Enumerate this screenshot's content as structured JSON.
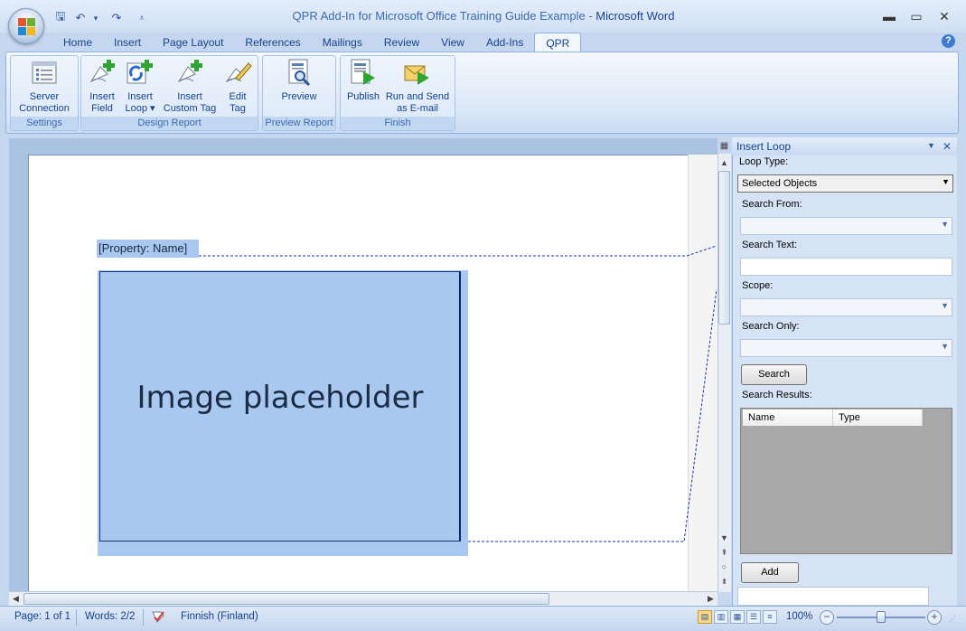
{
  "window": {
    "title_doc": "QPR Add-In for Microsoft Office Training Guide Example",
    "title_sep": " - ",
    "title_app": "Microsoft Word",
    "minimize": "▬",
    "maximize": "▭",
    "close": "✕"
  },
  "qat": {
    "save": "🖫",
    "undo": "↶",
    "undo_dd": "▾",
    "redo": "↷",
    "customize": "⩡"
  },
  "tabs": [
    "Home",
    "Insert",
    "Page Layout",
    "References",
    "Mailings",
    "Review",
    "View",
    "Add-Ins",
    "QPR"
  ],
  "help": "?",
  "ribbon": {
    "groups": [
      {
        "label": "Settings",
        "buttons": [
          {
            "l1": "Server",
            "l2": "Connection"
          }
        ]
      },
      {
        "label": "Design Report",
        "buttons": [
          {
            "l1": "Insert",
            "l2": "Field"
          },
          {
            "l1": "Insert",
            "l2": "Loop ▾"
          },
          {
            "l1": "Insert",
            "l2": "Custom Tag"
          },
          {
            "l1": "Edit",
            "l2": "Tag"
          }
        ]
      },
      {
        "label": "Preview Report",
        "buttons": [
          {
            "l1": "Preview",
            "l2": ""
          }
        ]
      },
      {
        "label": "Finish",
        "buttons": [
          {
            "l1": "Publish",
            "l2": ""
          },
          {
            "l1": "Run and Send",
            "l2": "as E-mail"
          }
        ]
      }
    ]
  },
  "document": {
    "field": "[Property: Name]",
    "image_text": "Image placeholder"
  },
  "pane": {
    "title": "Insert Loop",
    "menu": "▼",
    "close": "✕",
    "loop_type_label": "Loop Type:",
    "loop_type_value": "Selected Objects",
    "search_from_label": "Search From:",
    "search_text_label": "Search Text:",
    "scope_label": "Scope:",
    "search_only_label": "Search Only:",
    "search_button": "Search",
    "results_label": "Search Results:",
    "col_name": "Name",
    "col_type": "Type",
    "add_button": "Add"
  },
  "status": {
    "page": "Page: 1 of 1",
    "words": "Words: 2/2",
    "language": "Finnish (Finland)",
    "zoom": "100%",
    "zoom_out": "−",
    "zoom_in": "+",
    "zoom_level": 0.5
  },
  "colors": {
    "accent": "#15428b",
    "selection": "#a8c8ef"
  }
}
